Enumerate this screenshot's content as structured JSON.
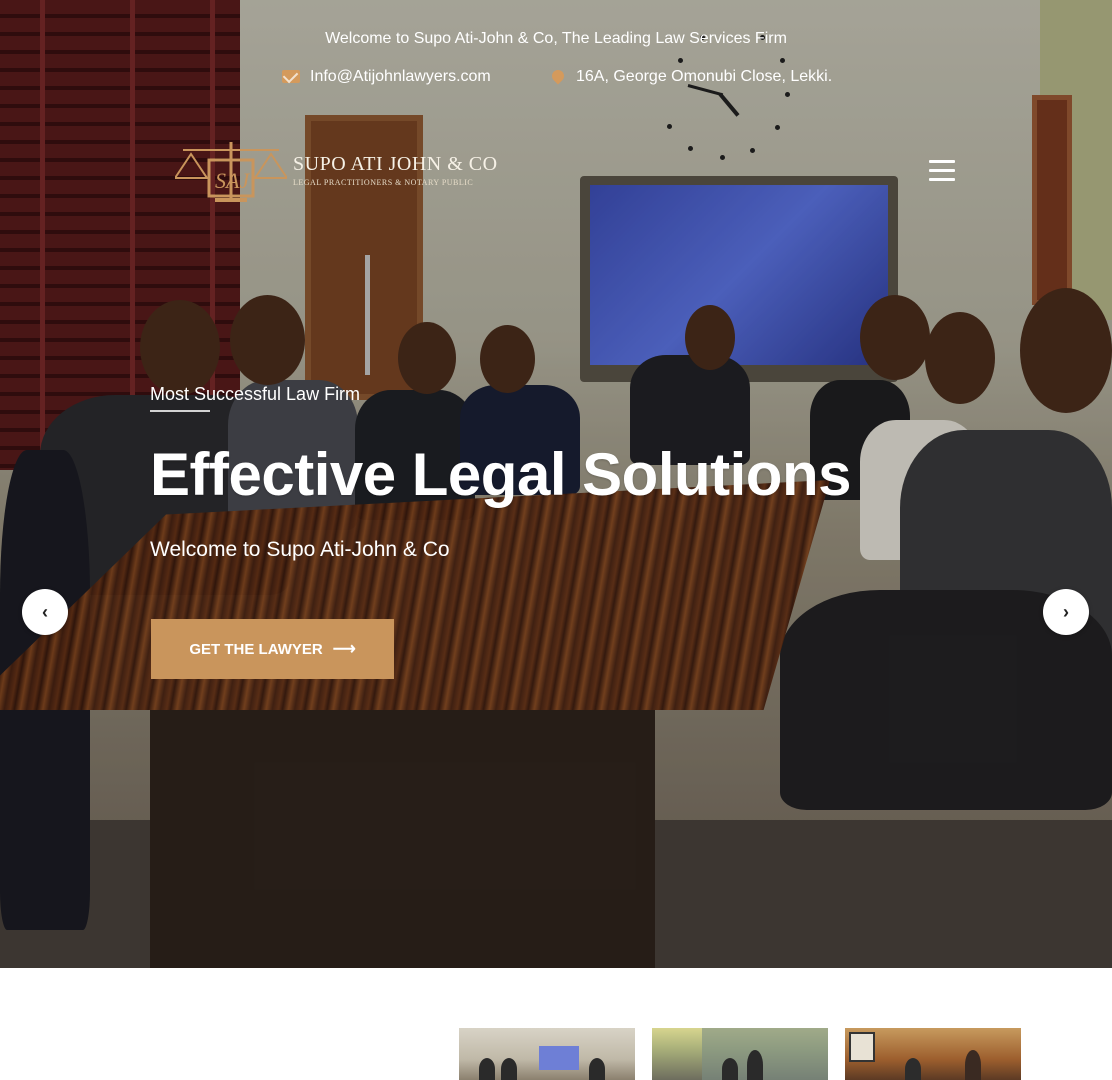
{
  "topbar": {
    "welcome": "Welcome to Supo Ati-John & Co, The Leading Law Services Firm",
    "email": "Info@Atijohnlawyers.com",
    "address": "16A, George Omonubi Close, Lekki."
  },
  "brand": {
    "name": "SUPO ATI JOHN & CO",
    "tagline": "LEGAL PRACTITIONERS & NOTARY PUBLIC",
    "accent_color": "#c9955c"
  },
  "hero": {
    "eyebrow": "Most Successful Law Firm",
    "headline": "Effective Legal Solutions",
    "subline": "Welcome to Supo Ati-John & Co",
    "cta_label": "GET THE LAWYER",
    "prev_label": "‹",
    "next_label": "›"
  },
  "icons": {
    "email": "mail-icon",
    "address": "map-pin-icon",
    "menu": "hamburger-menu-icon",
    "cta": "arrow-right-icon"
  }
}
